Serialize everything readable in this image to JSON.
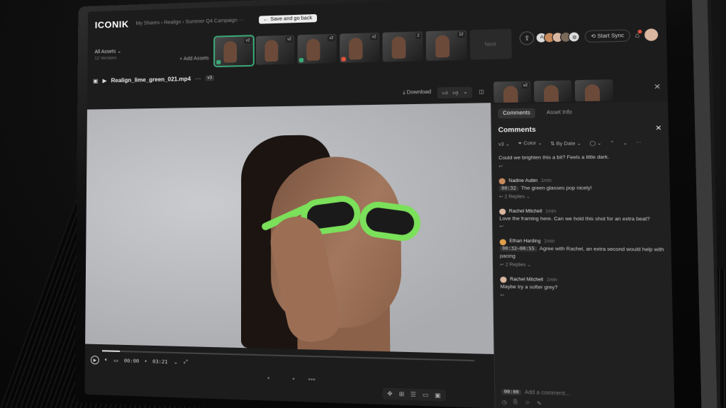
{
  "app": {
    "logo": "ICONIK",
    "breadcrumb": "My Shares › Realign › Summer Q4 Campaign ···",
    "save_back": "Save and go back"
  },
  "assets": {
    "all_label": "All Assets ⌄",
    "versions": "12 Versions",
    "add_label": "+ Add Assets",
    "next_label": "Next",
    "thumbs": [
      {
        "tag": "v2"
      },
      {
        "tag": "v2"
      },
      {
        "tag": "v2"
      },
      {
        "tag": "v2"
      },
      {
        "tag": "2"
      },
      {
        "tag": "12"
      }
    ],
    "right_thumbs": [
      {
        "tag": "v2"
      },
      {
        "tag": ""
      },
      {
        "tag": ""
      }
    ]
  },
  "header": {
    "start_sync": "Start Sync",
    "avatar_initial": "A"
  },
  "file": {
    "name": "Realign_lime_green_021.mp4",
    "version": "v3"
  },
  "player": {
    "download": "Download",
    "timecode_current": "00:00",
    "timecode_total": "03:21",
    "progress": 0.05
  },
  "panel": {
    "tab_comments": "Comments",
    "tab_info": "Asset Info",
    "title": "Comments",
    "filters": {
      "version": "v3 ⌄",
      "color": "Color ⌄",
      "sort": "By Date ⌄"
    },
    "comments": [
      {
        "author": "",
        "time": "",
        "stamp": "",
        "text": "Could we brighten this a bit? Feels a little dark.",
        "replies": "",
        "color": "#888"
      },
      {
        "author": "Nadine Aubin",
        "time": "1min",
        "stamp": "00:32",
        "text": "The green glasses pop nicely!",
        "replies": "2 Replies ⌄",
        "color": "#c98b5e"
      },
      {
        "author": "Rachel Mitchell",
        "time": "1min",
        "stamp": "",
        "text": "Love the framing here. Can we hold this shot for an extra beat?",
        "replies": "",
        "color": "#d9b7a0"
      },
      {
        "author": "Ethan Harding",
        "time": "1min",
        "stamp": "00:32–00:55",
        "text": "Agree with Rachel, an extra second would help with pacing",
        "replies": "2 Replies ⌄",
        "color": "#e0a04a"
      },
      {
        "author": "Rachel Mitchell",
        "time": "1min",
        "stamp": "",
        "text": "Maybe try a softer grey?",
        "replies": "",
        "color": "#d9b7a0"
      }
    ],
    "composer_stamp": "00:00",
    "composer_placeholder": "Add a comment..."
  }
}
